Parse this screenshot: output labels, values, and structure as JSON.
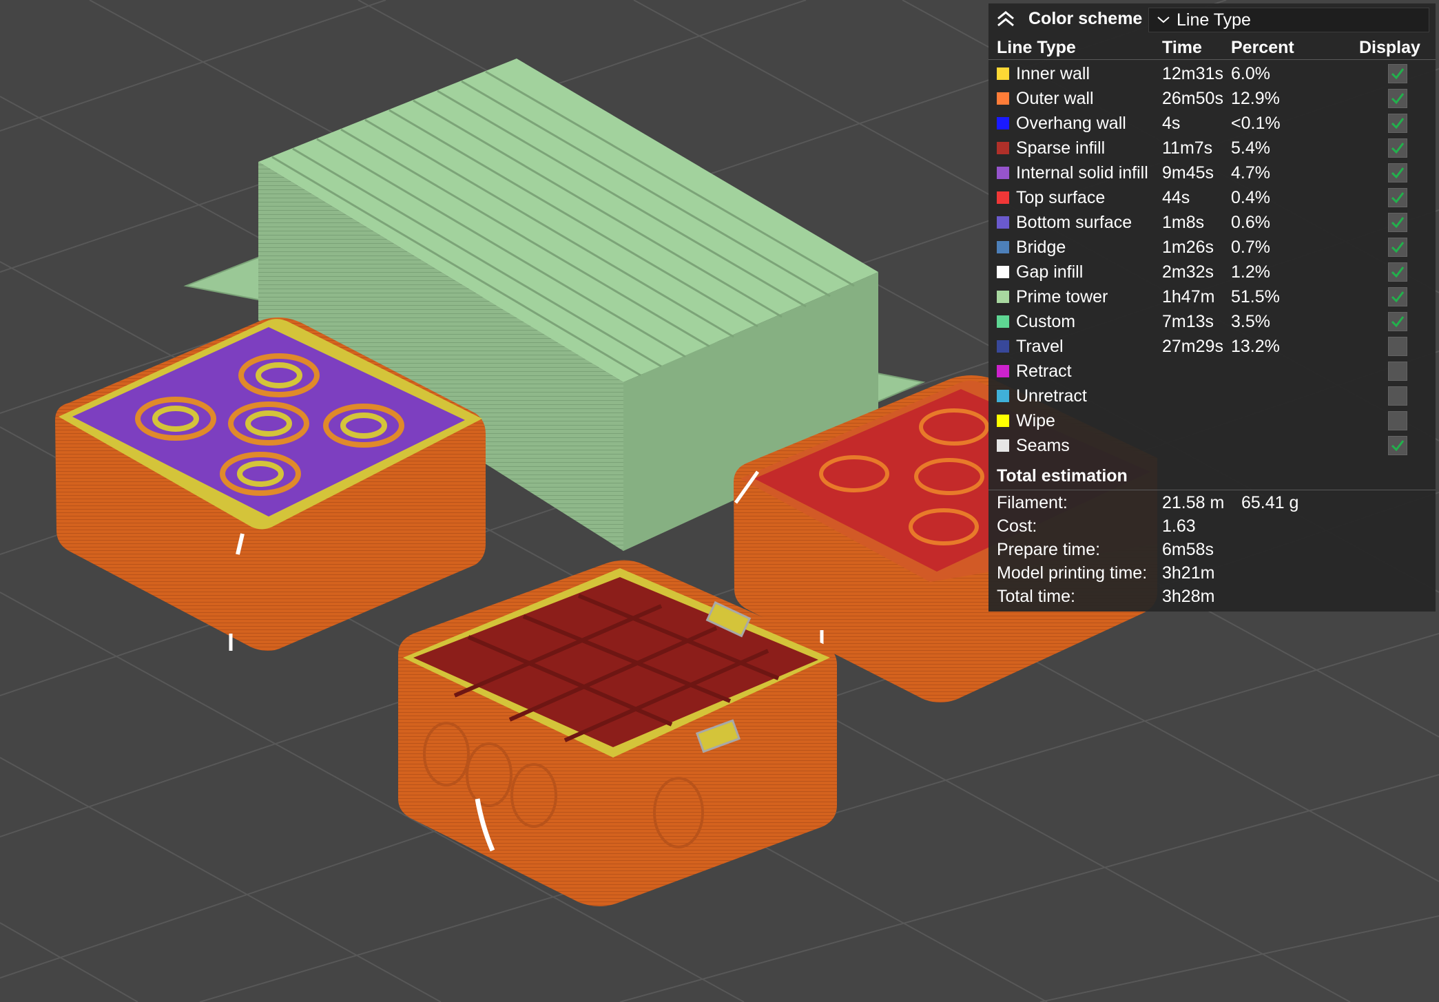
{
  "legend": {
    "title": "Color scheme",
    "scheme_value": "Line Type",
    "columns": {
      "type": "Line Type",
      "time": "Time",
      "percent": "Percent",
      "display": "Display"
    },
    "rows": [
      {
        "label": "Inner wall",
        "time": "12m31s",
        "percent": "6.0%",
        "color": "#fdd835",
        "display": true
      },
      {
        "label": "Outer wall",
        "time": "26m50s",
        "percent": "12.9%",
        "color": "#ff7d38",
        "display": true
      },
      {
        "label": "Overhang wall",
        "time": "4s",
        "percent": "<0.1%",
        "color": "#1a1aff",
        "display": true
      },
      {
        "label": "Sparse infill",
        "time": "11m7s",
        "percent": "5.4%",
        "color": "#b03029",
        "display": true
      },
      {
        "label": "Internal solid infill",
        "time": "9m45s",
        "percent": "4.7%",
        "color": "#9654cc",
        "display": true
      },
      {
        "label": "Top surface",
        "time": "44s",
        "percent": "0.4%",
        "color": "#f03737",
        "display": true
      },
      {
        "label": "Bottom surface",
        "time": "1m8s",
        "percent": "0.6%",
        "color": "#6a5acd",
        "display": true
      },
      {
        "label": "Bridge",
        "time": "1m26s",
        "percent": "0.7%",
        "color": "#4d80ba",
        "display": true
      },
      {
        "label": "Gap infill",
        "time": "2m32s",
        "percent": "1.2%",
        "color": "#ffffff",
        "display": true
      },
      {
        "label": "Prime tower",
        "time": "1h47m",
        "percent": "51.5%",
        "color": "#a8d8a0",
        "display": true
      },
      {
        "label": "Custom",
        "time": "7m13s",
        "percent": "3.5%",
        "color": "#5ed693",
        "display": true
      },
      {
        "label": "Travel",
        "time": "27m29s",
        "percent": "13.2%",
        "color": "#38489a",
        "display": false
      },
      {
        "label": "Retract",
        "time": "",
        "percent": "",
        "color": "#cd22cd",
        "display": false
      },
      {
        "label": "Unretract",
        "time": "",
        "percent": "",
        "color": "#40b0d8",
        "display": false
      },
      {
        "label": "Wipe",
        "time": "",
        "percent": "",
        "color": "#ffff00",
        "display": false
      },
      {
        "label": "Seams",
        "time": "",
        "percent": "",
        "color": "#e6e6e6",
        "display": true
      }
    ],
    "total_title": "Total estimation",
    "filament_label": "Filament:",
    "filament_length": "21.58 m",
    "filament_weight": "65.41 g",
    "cost_label": "Cost:",
    "cost_value": "1.63",
    "prepare_label": "Prepare time:",
    "prepare_value": "6m58s",
    "model_label": "Model printing time:",
    "model_value": "3h21m",
    "total_label": "Total time:",
    "total_value": "3h28m",
    "check_color": "#22b14c"
  },
  "scene": {
    "background": "#454545",
    "grid_color": "#575757",
    "prime_tower_color": "#8fb88a",
    "outer_wall_color": "#d9651f",
    "inner_wall_color": "#d4c43a",
    "internal_solid_color": "#7d3fc0",
    "top_surface_color": "#c42a2a",
    "sparse_infill_color": "#8c1e1a",
    "seam_color": "#ffffff"
  }
}
